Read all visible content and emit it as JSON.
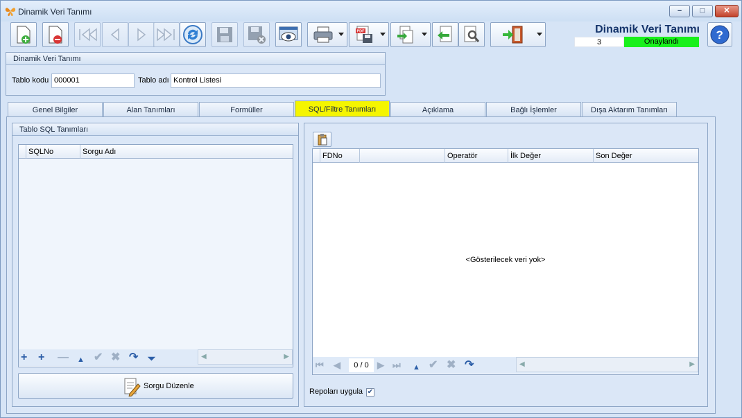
{
  "window": {
    "title": "Dinamik Veri Tanımı"
  },
  "header": {
    "title": "Dinamik Veri Tanımı",
    "record_number": "3",
    "status": "Onaylandı",
    "status_color": "#19f01c"
  },
  "toolbar": {
    "icons": [
      "new-record-icon",
      "delete-record-icon",
      "first-record-icon",
      "previous-record-icon",
      "next-record-icon",
      "last-record-icon",
      "refresh-icon",
      "save-icon",
      "cancel-save-icon",
      "preview-icon",
      "print-icon",
      "pdf-export-icon",
      "import-icon",
      "back-icon",
      "tools-icon",
      "exit-icon",
      "help-icon"
    ]
  },
  "definition": {
    "group_title": "Dinamik Veri Tanımı",
    "code_label": "Tablo kodu",
    "code_value": "000001",
    "name_label": "Tablo adı",
    "name_value": "Kontrol Listesi"
  },
  "tabs": [
    {
      "label": "Genel Bilgiler",
      "active": false
    },
    {
      "label": "Alan Tanımları",
      "active": false
    },
    {
      "label": "Formüller",
      "active": false
    },
    {
      "label": "SQL/Filtre Tanımları",
      "active": true
    },
    {
      "label": "Açıklama",
      "active": false
    },
    {
      "label": "Bağlı İşlemler",
      "active": false
    },
    {
      "label": "Dışa Aktarım Tanımları",
      "active": false
    }
  ],
  "sql_panel": {
    "group_title": "Tablo SQL Tanımları",
    "columns": [
      "SQLNo",
      "Sorgu Adı"
    ],
    "edit_button": "Sorgu Düzenle"
  },
  "filter_panel": {
    "columns": [
      "FDNo",
      "",
      "Operatör",
      "İlk Değer",
      "Son Değer"
    ],
    "empty_text": "<Gösterilecek veri yok>",
    "pager": "0 / 0",
    "apply_repos_label": "Repoları uygula",
    "apply_repos_checked": true
  }
}
